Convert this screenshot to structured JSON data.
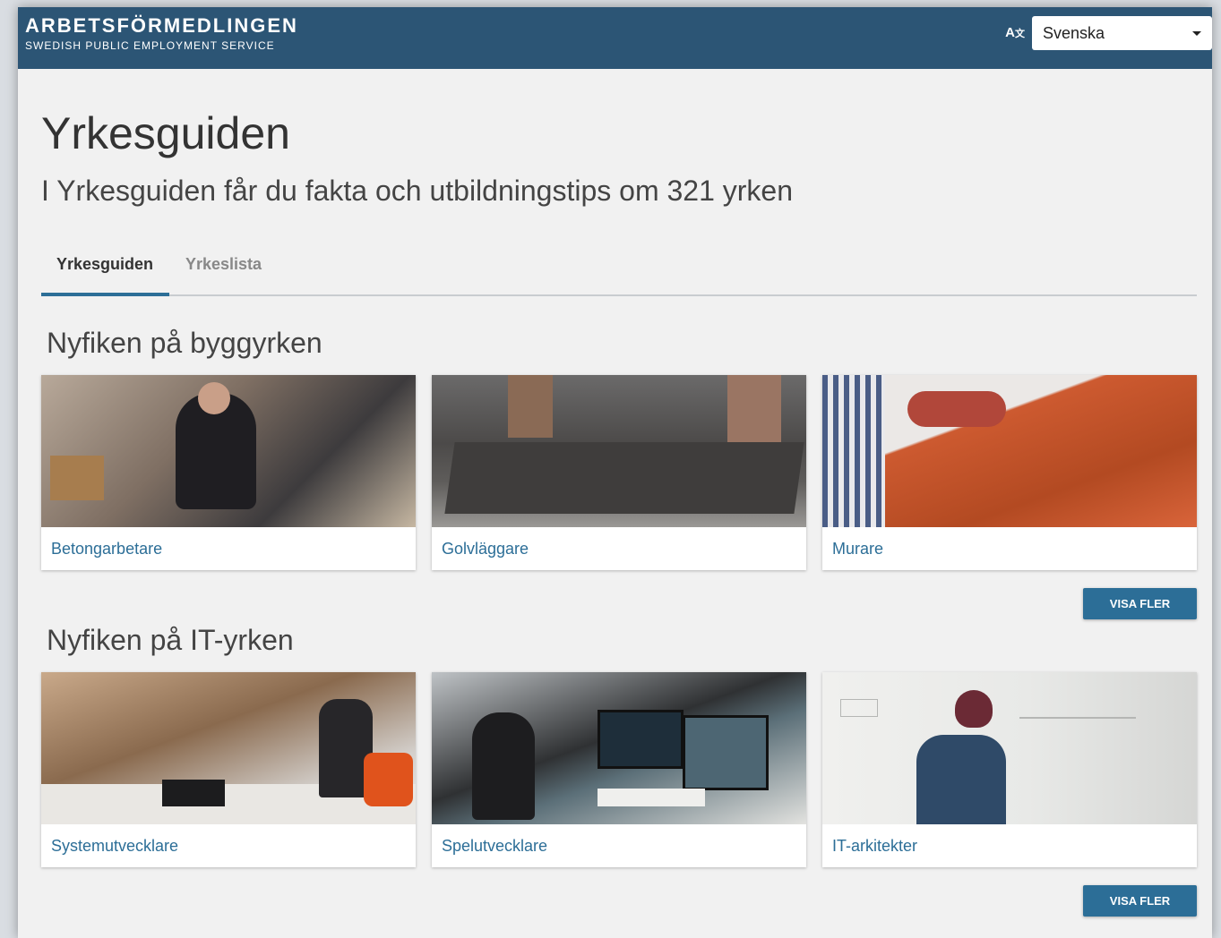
{
  "header": {
    "brand_title": "ARBETSFÖRMEDLINGEN",
    "brand_subtitle": "SWEDISH PUBLIC EMPLOYMENT SERVICE",
    "language_icon": "translate-icon",
    "language_selected": "Svenska"
  },
  "page": {
    "title": "Yrkesguiden",
    "subtitle": "I Yrkesguiden får du fakta och utbildningstips om 321 yrken"
  },
  "tabs": [
    {
      "label": "Yrkesguiden",
      "active": true
    },
    {
      "label": "Yrkeslista",
      "active": false
    }
  ],
  "sections": [
    {
      "title": "Nyfiken på byggyrken",
      "cards": [
        {
          "label": "Betongarbetare"
        },
        {
          "label": "Golvläggare"
        },
        {
          "label": "Murare"
        }
      ],
      "more_label": "VISA FLER"
    },
    {
      "title": "Nyfiken på IT-yrken",
      "cards": [
        {
          "label": "Systemutvecklare"
        },
        {
          "label": "Spelutvecklare"
        },
        {
          "label": "IT-arkitekter"
        }
      ],
      "more_label": "VISA FLER"
    }
  ],
  "colors": {
    "header_bg": "#2c5575",
    "accent": "#2c6e97",
    "page_bg": "#f1f1f1"
  }
}
